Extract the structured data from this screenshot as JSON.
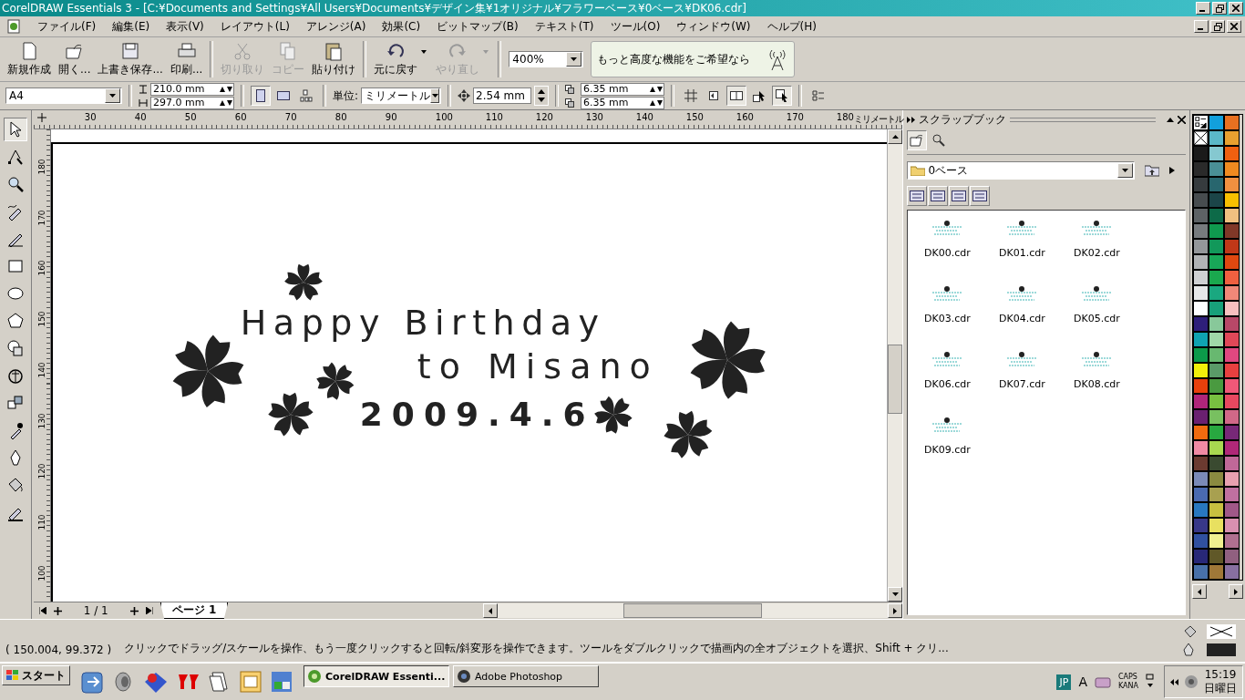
{
  "window": {
    "title": "CorelDRAW Essentials 3 - [C:¥Documents and Settings¥All Users¥Documents¥デザイン集¥1オリジナル¥フラワーベース¥0ベース¥DK06.cdr]"
  },
  "menu": [
    "ファイル(F)",
    "編集(E)",
    "表示(V)",
    "レイアウト(L)",
    "アレンジ(A)",
    "効果(C)",
    "ビットマップ(B)",
    "テキスト(T)",
    "ツール(O)",
    "ウィンドウ(W)",
    "ヘルプ(H)"
  ],
  "toolbar": [
    {
      "kind": "new",
      "label": "新規作成",
      "disabled": false,
      "dropdown": false
    },
    {
      "kind": "open",
      "label": "開く...",
      "disabled": false,
      "dropdown": false
    },
    {
      "kind": "save",
      "label": "上書き保存...",
      "disabled": false,
      "dropdown": false
    },
    {
      "kind": "print",
      "label": "印刷...",
      "disabled": false,
      "dropdown": false
    },
    {
      "kind": "cut",
      "label": "切り取り",
      "disabled": true,
      "dropdown": false
    },
    {
      "kind": "copy",
      "label": "コピー",
      "disabled": true,
      "dropdown": false
    },
    {
      "kind": "paste",
      "label": "貼り付け",
      "disabled": false,
      "dropdown": false
    },
    {
      "kind": "undo",
      "label": "元に戻す",
      "disabled": false,
      "dropdown": true
    },
    {
      "kind": "redo",
      "label": "やり直し",
      "disabled": true,
      "dropdown": true
    }
  ],
  "zoom": {
    "value": "400%"
  },
  "promo": {
    "text": "もっと高度な機能をご希望なら"
  },
  "property_bar": {
    "paper": "A4",
    "width": "210.0 mm",
    "height": "297.0 mm",
    "orientation": [
      {
        "kind": "portrait",
        "selected": true
      },
      {
        "kind": "landscape",
        "selected": false
      }
    ],
    "units_label": "単位:",
    "units": "ミリメートル",
    "nudge": "2.54 mm",
    "dup_x": "6.35 mm",
    "dup_y": "6.35 mm"
  },
  "toolbox": [
    {
      "kind": "pick",
      "selected": true
    },
    {
      "kind": "shape",
      "selected": false
    },
    {
      "kind": "zoom",
      "selected": false
    },
    {
      "kind": "freehand",
      "selected": false
    },
    {
      "kind": "smart",
      "selected": false
    },
    {
      "kind": "rect",
      "selected": false
    },
    {
      "kind": "ellipse",
      "selected": false
    },
    {
      "kind": "polygon",
      "selected": false
    },
    {
      "kind": "basic",
      "selected": false
    },
    {
      "kind": "text",
      "selected": false
    },
    {
      "kind": "blend",
      "selected": false
    },
    {
      "kind": "eyedropper",
      "selected": false
    },
    {
      "kind": "outline",
      "selected": false
    },
    {
      "kind": "fill",
      "selected": false
    },
    {
      "kind": "interactive",
      "selected": false
    }
  ],
  "ruler": {
    "h_labels": [
      "30",
      "40",
      "50",
      "60",
      "70",
      "80",
      "90",
      "100",
      "110",
      "120",
      "130",
      "140",
      "150",
      "160",
      "170",
      "180"
    ],
    "unit": "ミリメートル",
    "v_labels": [
      "180",
      "170",
      "160",
      "150",
      "140",
      "130",
      "120",
      "110",
      "100"
    ]
  },
  "artwork": {
    "lines": [
      "Happy Birthday",
      "to Misano",
      "2009.4.6"
    ]
  },
  "page_nav": {
    "count": "1 / 1",
    "tab": "ページ 1"
  },
  "scrapbook": {
    "title": "スクラップブック",
    "folder": "0ベース",
    "items": [
      {
        "name": "DK00.cdr"
      },
      {
        "name": "DK01.cdr"
      },
      {
        "name": "DK02.cdr"
      },
      {
        "name": "DK03.cdr"
      },
      {
        "name": "DK04.cdr"
      },
      {
        "name": "DK05.cdr"
      },
      {
        "name": "DK06.cdr"
      },
      {
        "name": "DK07.cdr"
      },
      {
        "name": "DK08.cdr"
      },
      {
        "name": "DK09.cdr"
      }
    ]
  },
  "palette": [
    {
      "kind": "options"
    },
    {
      "kind": "swatch",
      "color": "#12a0dc"
    },
    {
      "kind": "swatch",
      "color": "#e87020"
    },
    {
      "kind": "none"
    },
    {
      "kind": "swatch",
      "color": "#5bb8c8"
    },
    {
      "kind": "swatch",
      "color": "#e8a030"
    },
    {
      "kind": "swatch",
      "color": "#1a1a1a"
    },
    {
      "kind": "swatch",
      "color": "#85c8d0"
    },
    {
      "kind": "swatch",
      "color": "#f06010"
    },
    {
      "kind": "swatch",
      "color": "#2a2a2a"
    },
    {
      "kind": "swatch",
      "color": "#4a8f96"
    },
    {
      "kind": "swatch",
      "color": "#f08a20"
    },
    {
      "kind": "swatch",
      "color": "#363b3e"
    },
    {
      "kind": "swatch",
      "color": "#28666e"
    },
    {
      "kind": "swatch",
      "color": "#f09040"
    },
    {
      "kind": "swatch",
      "color": "#474c4f"
    },
    {
      "kind": "swatch",
      "color": "#1b4548"
    },
    {
      "kind": "swatch",
      "color": "#f8c000"
    },
    {
      "kind": "swatch",
      "color": "#5d6265"
    },
    {
      "kind": "swatch",
      "color": "#0d6a48"
    },
    {
      "kind": "swatch",
      "color": "#f0c080"
    },
    {
      "kind": "swatch",
      "color": "#777b7e"
    },
    {
      "kind": "swatch",
      "color": "#0f9a4e"
    },
    {
      "kind": "swatch",
      "color": "#803828"
    },
    {
      "kind": "swatch",
      "color": "#94979a"
    },
    {
      "kind": "swatch",
      "color": "#12985a"
    },
    {
      "kind": "swatch",
      "color": "#c03818"
    },
    {
      "kind": "swatch",
      "color": "#b1b3b5"
    },
    {
      "kind": "swatch",
      "color": "#18a858"
    },
    {
      "kind": "swatch",
      "color": "#e04810"
    },
    {
      "kind": "swatch",
      "color": "#cfd0d2"
    },
    {
      "kind": "swatch",
      "color": "#1aa84e"
    },
    {
      "kind": "swatch",
      "color": "#f06040"
    },
    {
      "kind": "swatch",
      "color": "#e6e7e8"
    },
    {
      "kind": "swatch",
      "color": "#1aa880"
    },
    {
      "kind": "swatch",
      "color": "#f08878"
    },
    {
      "kind": "swatch",
      "color": "#ffffff"
    },
    {
      "kind": "swatch",
      "color": "#18a07a"
    },
    {
      "kind": "swatch",
      "color": "#f8c0c0"
    },
    {
      "kind": "swatch",
      "color": "#2e1f7a"
    },
    {
      "kind": "swatch",
      "color": "#88c89a"
    },
    {
      "kind": "swatch",
      "color": "#b84868"
    },
    {
      "kind": "swatch",
      "color": "#0fa3b1"
    },
    {
      "kind": "swatch",
      "color": "#a0d8a8"
    },
    {
      "kind": "swatch",
      "color": "#e04858"
    },
    {
      "kind": "swatch",
      "color": "#0c9a4a"
    },
    {
      "kind": "swatch",
      "color": "#68b870"
    },
    {
      "kind": "swatch",
      "color": "#e04880"
    },
    {
      "kind": "swatch",
      "color": "#f2ef0a"
    },
    {
      "kind": "swatch",
      "color": "#5a9a68"
    },
    {
      "kind": "swatch",
      "color": "#e84040"
    },
    {
      "kind": "swatch",
      "color": "#e8400c"
    },
    {
      "kind": "swatch",
      "color": "#4a9a40"
    },
    {
      "kind": "swatch",
      "color": "#f05878"
    },
    {
      "kind": "swatch",
      "color": "#b0257a"
    },
    {
      "kind": "swatch",
      "color": "#78c040"
    },
    {
      "kind": "swatch",
      "color": "#e84860"
    },
    {
      "kind": "swatch",
      "color": "#6a2070"
    },
    {
      "kind": "swatch",
      "color": "#78c060"
    },
    {
      "kind": "swatch",
      "color": "#d06888"
    },
    {
      "kind": "swatch",
      "color": "#f06b0f"
    },
    {
      "kind": "swatch",
      "color": "#28a840"
    },
    {
      "kind": "swatch",
      "color": "#782878"
    },
    {
      "kind": "swatch",
      "color": "#f08aa4"
    },
    {
      "kind": "swatch",
      "color": "#a8d850"
    },
    {
      "kind": "swatch",
      "color": "#b02878"
    },
    {
      "kind": "swatch",
      "color": "#6b3a30"
    },
    {
      "kind": "swatch",
      "color": "#3a4a30"
    },
    {
      "kind": "swatch",
      "color": "#c06898"
    },
    {
      "kind": "swatch",
      "color": "#7a8ab8"
    },
    {
      "kind": "swatch",
      "color": "#8a8a40"
    },
    {
      "kind": "swatch",
      "color": "#e8a0b0"
    },
    {
      "kind": "swatch",
      "color": "#4a6ab0"
    },
    {
      "kind": "swatch",
      "color": "#a8a050"
    },
    {
      "kind": "swatch",
      "color": "#c070a0"
    },
    {
      "kind": "swatch",
      "color": "#2878c0"
    },
    {
      "kind": "swatch",
      "color": "#c8c040"
    },
    {
      "kind": "swatch",
      "color": "#a05888"
    },
    {
      "kind": "swatch",
      "color": "#383888"
    },
    {
      "kind": "swatch",
      "color": "#e8e060"
    },
    {
      "kind": "swatch",
      "color": "#d890b0"
    },
    {
      "kind": "swatch",
      "color": "#3050a0"
    },
    {
      "kind": "swatch",
      "color": "#f0f090"
    },
    {
      "kind": "swatch",
      "color": "#b07090"
    },
    {
      "kind": "swatch",
      "color": "#282878"
    },
    {
      "kind": "swatch",
      "color": "#605828"
    },
    {
      "kind": "swatch",
      "color": "#906080"
    },
    {
      "kind": "swatch",
      "color": "#4870a8"
    },
    {
      "kind": "swatch",
      "color": "#a07838"
    },
    {
      "kind": "swatch",
      "color": "#8870a0"
    }
  ],
  "status_bar": {
    "coords": "( 150.004, 99.372 )",
    "message": "クリックでドラッグ/スケールを操作、もう一度クリックすると回転/斜変形を操作できます。ツールをダブルクリックで描画内の全オブジェクトを選択、Shift + クリ..."
  },
  "taskbar": {
    "start": "スタート",
    "tasks": [
      {
        "label": "CorelDRAW Essenti...",
        "selected": true
      },
      {
        "label": "Adobe Photoshop",
        "selected": false
      }
    ],
    "ime": "JP",
    "ime_mode": "A",
    "caps": "CAPS",
    "kana": "KANA",
    "time": "15:19",
    "day": "日曜日"
  }
}
